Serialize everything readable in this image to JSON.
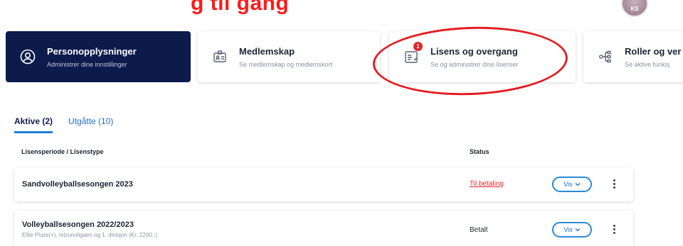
{
  "banner": {
    "red_text": "g til gang",
    "avatar_initials": "KS"
  },
  "cards": [
    {
      "title": "Personopplysninger",
      "subtitle": "Administrer dine innstillinger",
      "icon": "user-circle-icon",
      "active": true
    },
    {
      "title": "Medlemskap",
      "subtitle": "Se medlemskap og medlemskort",
      "icon": "id-card-icon",
      "active": false
    },
    {
      "title": "Lisens og overgang",
      "subtitle": "Se og administrer dine lisenser",
      "icon": "license-document-icon",
      "badge": "1",
      "active": false
    },
    {
      "title": "Roller og ver",
      "subtitle": "Se aktive funksj",
      "icon": "roles-tree-icon",
      "active": false
    }
  ],
  "tabs": [
    {
      "label": "Aktive (2)",
      "active": true
    },
    {
      "label": "Utgåtte (10)",
      "active": false
    }
  ],
  "table": {
    "headers": {
      "period": "Lisensperiode / Lisenstype",
      "status": "Status"
    },
    "rows": [
      {
        "name": "Sandvolleyballsesongen 2023",
        "description": "",
        "status": "Til betaling",
        "status_color": "#e0262a",
        "action": "Vis"
      },
      {
        "name": "Volleyballsesongen 2022/2023",
        "description": "Elite Pluss(+), mizunoligaen og 1. divisjon (Kr. 2200,-)",
        "status": "Betalt",
        "status_color": "#1d2433",
        "action": "Vis"
      }
    ]
  },
  "colors": {
    "accent": "#0d1b4c",
    "link": "#1f6fc8",
    "highlight_ellipse": "#e41d21"
  }
}
